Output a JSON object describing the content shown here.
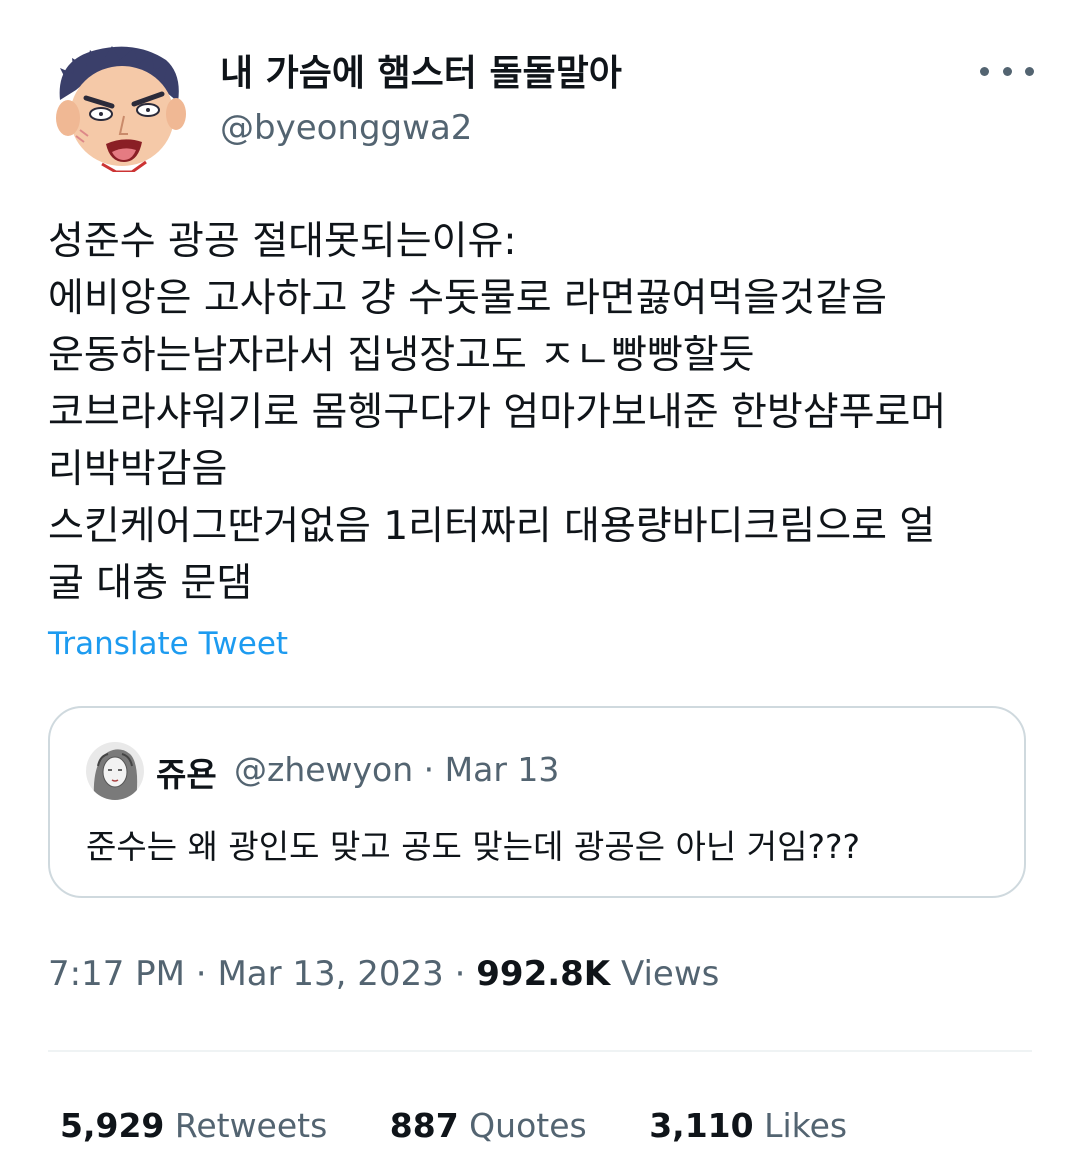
{
  "author": {
    "display_name": "내 가슴에 햄스터 돌돌말아",
    "handle": "@byeonggwa2"
  },
  "more_icon": "more-horizontal-icon",
  "tweet_lines": [
    "성준수 광공 절대못되는이유:",
    "에비앙은 고사하고 걍 수돗물로 라면끓여먹을것같음",
    "운동하는남자라서 집냉장고도 ㅈㄴ빵빵할듯",
    "코브라샤워기로 몸헹구다가 엄마가보내준 한방샴푸로머",
    "리박박감음",
    "스킨케어그딴거없음 1리터짜리 대용량바디크림으로 얼",
    "굴 대충 문댐"
  ],
  "translate_label": "Translate Tweet",
  "quoted": {
    "display_name": "쥬욘",
    "meta": "@zhewyon · Mar 13",
    "text": "준수는 왜 광인도 맞고 공도 맞는데 광공은 아닌 거임???"
  },
  "timestamp": {
    "time": "7:17 PM",
    "sep1": " · ",
    "date": "Mar 13, 2023",
    "sep2": " · ",
    "views_count": "992.8K",
    "views_label": " Views"
  },
  "stats": {
    "retweets_count": "5,929",
    "retweets_label": " Retweets",
    "quotes_count": "887",
    "quotes_label": " Quotes",
    "likes_count": "3,110",
    "likes_label": " Likes"
  },
  "colors": {
    "text_primary": "#0f1419",
    "text_secondary": "#536471",
    "link": "#1d9bf0",
    "border": "#cfd9de"
  }
}
